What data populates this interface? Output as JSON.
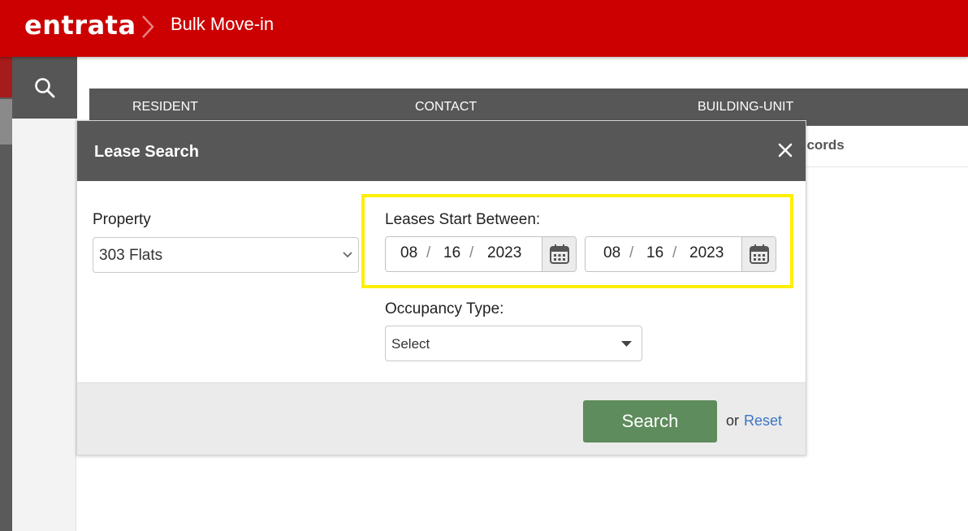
{
  "header": {
    "logo_text": "entrata",
    "page_title": "Bulk Move-in"
  },
  "background": {
    "tabs": [
      {
        "label": "RESIDENT"
      },
      {
        "label": "CONTACT"
      },
      {
        "label": "BUILDING-UNIT"
      }
    ],
    "records_text": "ecords"
  },
  "modal": {
    "title": "Lease Search",
    "property": {
      "label": "Property",
      "value": "303 Flats"
    },
    "lease_start": {
      "label": "Leases Start Between:",
      "start": {
        "month": "08",
        "day": "16",
        "year": "2023"
      },
      "end": {
        "month": "08",
        "day": "16",
        "year": "2023"
      },
      "separator": "/"
    },
    "occupancy": {
      "label": "Occupancy Type:",
      "value": "Select"
    },
    "footer": {
      "search_label": "Search",
      "or_text": "or",
      "reset_label": "Reset"
    }
  },
  "colors": {
    "brand_red": "#cc0000",
    "header_gray": "#575757",
    "search_green": "#5e8c5c",
    "highlight_yellow": "#ffef00",
    "link_blue": "#3b74c4"
  },
  "icons": {
    "search": "search-icon",
    "close": "close-icon",
    "calendar": "calendar-icon",
    "chevron_down": "chevron-down-icon",
    "caret_down": "caret-down-icon",
    "breadcrumb_chevron": "chevron-right-icon"
  }
}
